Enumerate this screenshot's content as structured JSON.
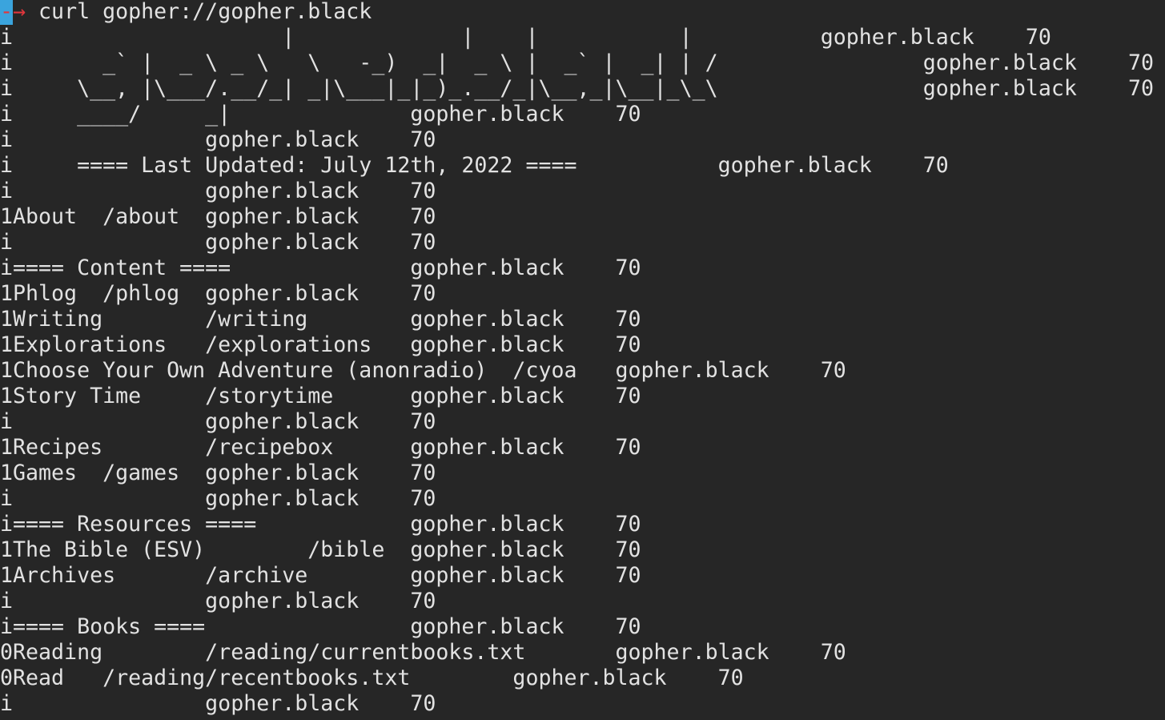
{
  "prompt": {
    "cursor": "-",
    "arrow": "→",
    "command": " curl gopher://gopher.black"
  },
  "lines": [
    "i                     |             |    |           |          gopher.black    70",
    "i       _` |  _ \\ _ \\   \\   -_)  _|  _ \\ |  _` |  _| | /                gopher.black    70",
    "i     \\__, |\\___/.__/_| _|\\___|_|_)_.__/_|\\__,_|\\__|_\\_\\                gopher.black    70",
    "i     ____/     _|              gopher.black    70",
    "i               gopher.black    70",
    "i     ==== Last Updated: July 12th, 2022 ====           gopher.black    70",
    "i               gopher.black    70",
    "1About  /about  gopher.black    70",
    "i               gopher.black    70",
    "i==== Content ====              gopher.black    70",
    "1Phlog  /phlog  gopher.black    70",
    "1Writing        /writing        gopher.black    70",
    "1Explorations   /explorations   gopher.black    70",
    "1Choose Your Own Adventure (anonradio)  /cyoa   gopher.black    70",
    "1Story Time     /storytime      gopher.black    70",
    "i               gopher.black    70",
    "1Recipes        /recipebox      gopher.black    70",
    "1Games  /games  gopher.black    70",
    "i               gopher.black    70",
    "i==== Resources ====            gopher.black    70",
    "1The Bible (ESV)        /bible  gopher.black    70",
    "1Archives       /archive        gopher.black    70",
    "i               gopher.black    70",
    "i==== Books ====                gopher.black    70",
    "0Reading        /reading/currentbooks.txt       gopher.black    70",
    "0Read   /reading/recentbooks.txt        gopher.black    70",
    "i               gopher.black    70"
  ]
}
